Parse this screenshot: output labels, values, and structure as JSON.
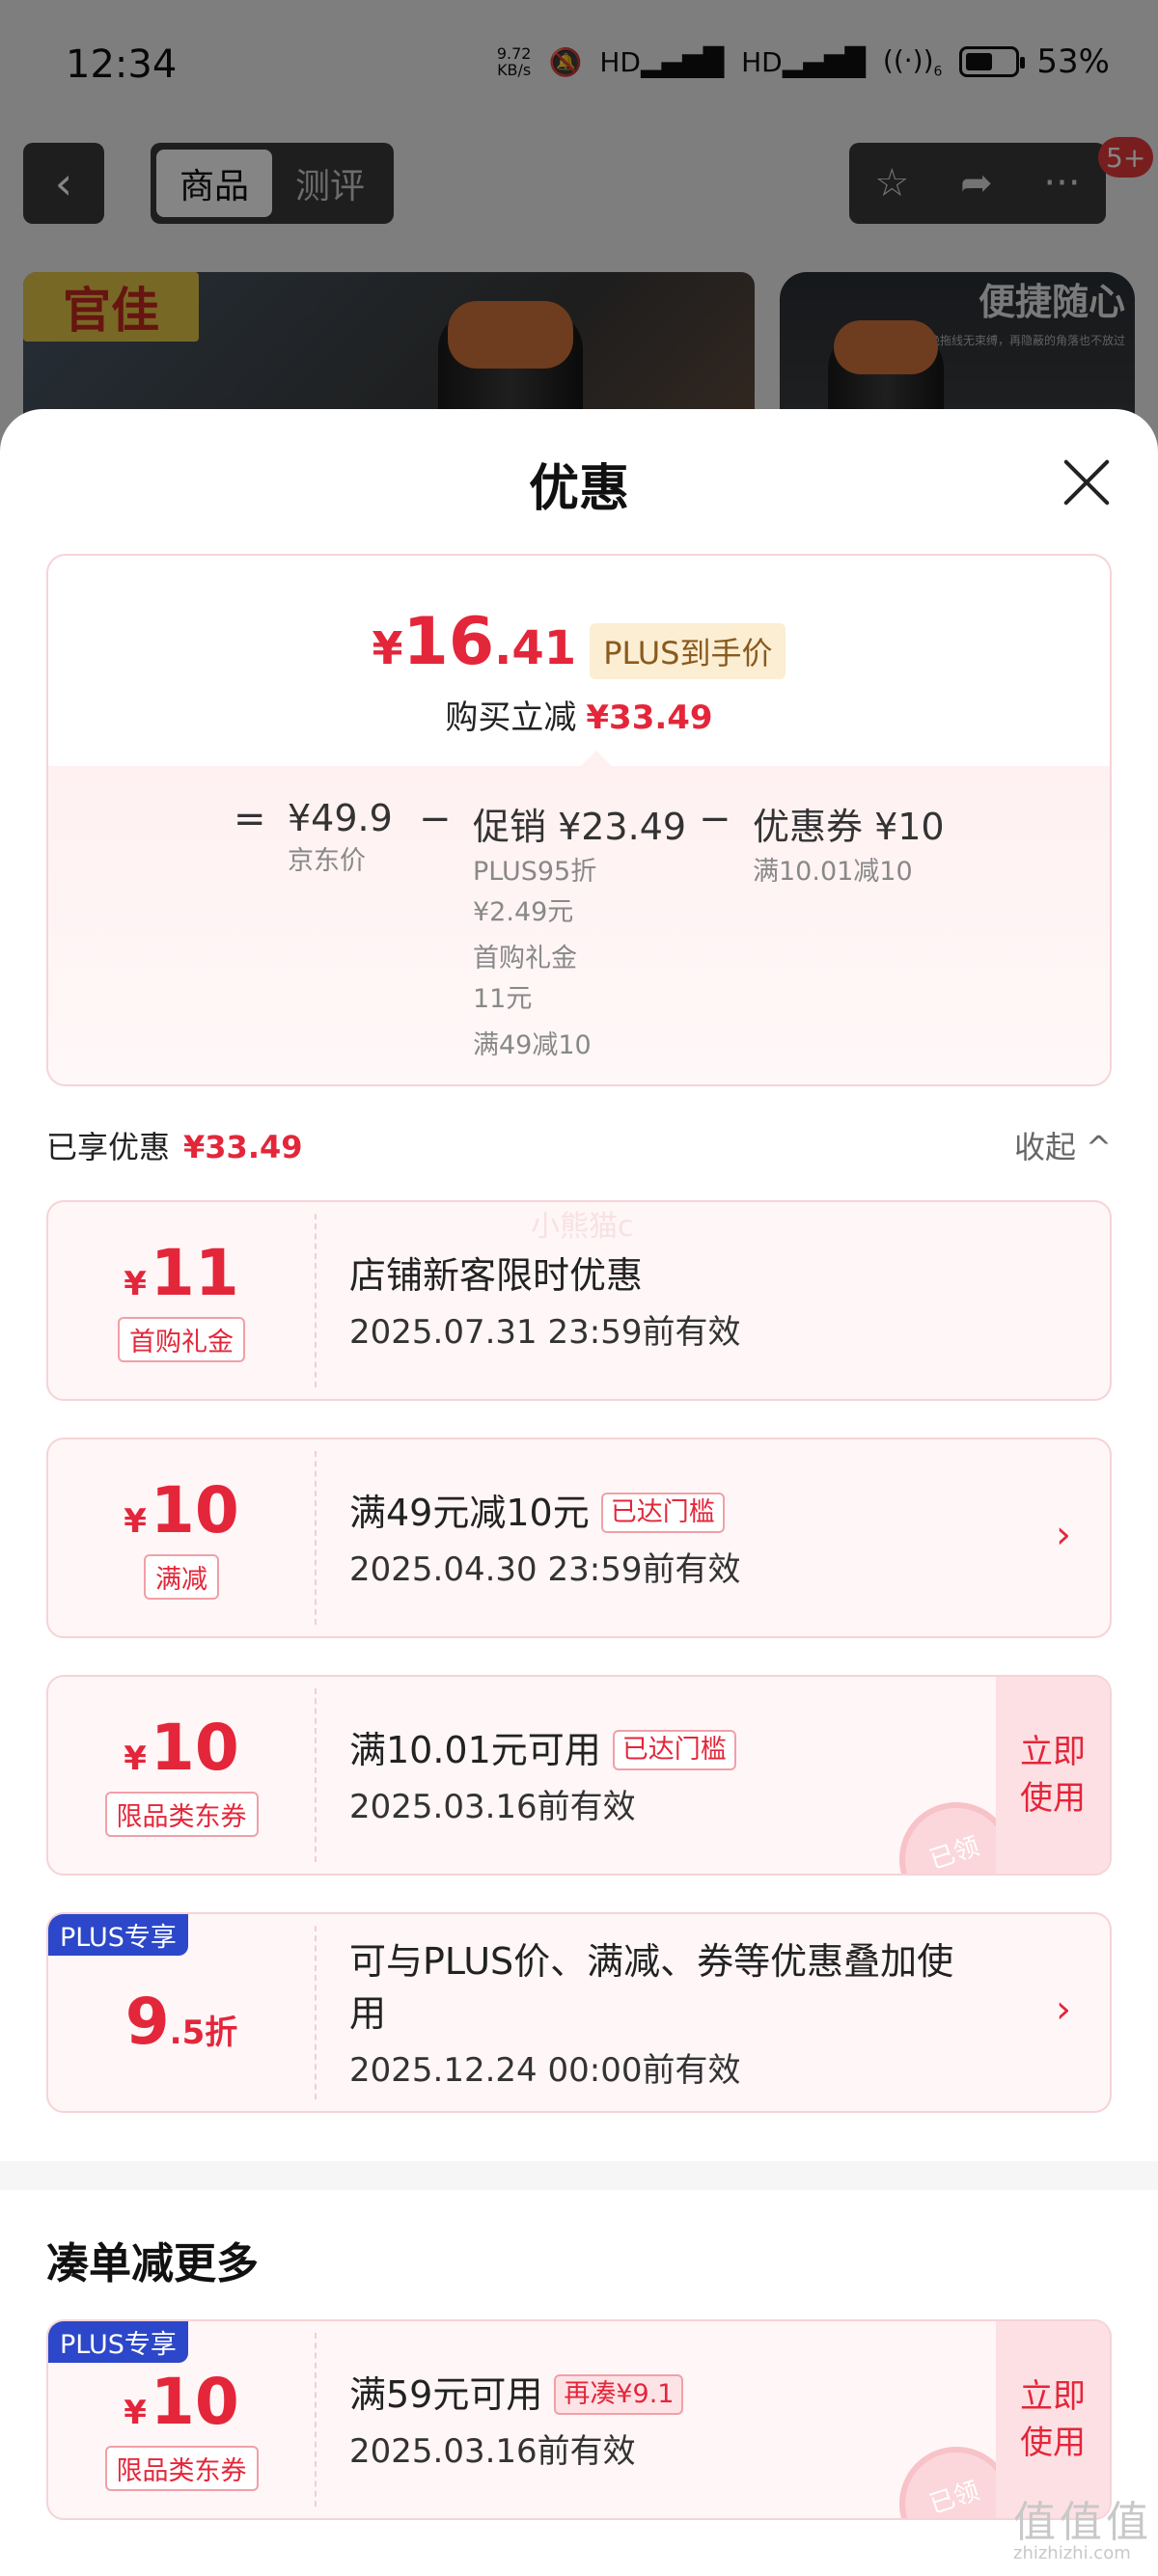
{
  "status_bar": {
    "time": "12:34",
    "net_speed_value": "9.72",
    "net_speed_unit": "KB/s",
    "signal_1": "HD",
    "signal_2": "HD",
    "wifi_level": "6",
    "battery_level": 0.53,
    "battery_text": "53%"
  },
  "top_nav": {
    "tab_product": "商品",
    "tab_review": "测评",
    "notification_count": "5+"
  },
  "banners": {
    "logo_text": "官佳",
    "side_title": "便捷随心",
    "side_sub": "拒绝拖线无束缚，再隐蔽的角落也不放过"
  },
  "sheet": {
    "title": "优惠",
    "final_currency": "¥",
    "final_int": "16",
    "final_dec": ".41",
    "plus_label": "PLUS到手价",
    "reduce_label": "购买立减",
    "reduce_amount": "¥33.49",
    "calc": {
      "eq": "=",
      "jd_price": "¥49.9",
      "jd_label": "京东价",
      "minus1": "−",
      "promo_main": "促销 ¥23.49",
      "promo_line1": "PLUS95折",
      "promo_line2": "¥2.49元",
      "promo_line3": "首购礼金",
      "promo_line4": "11元",
      "promo_line5": "满49减10",
      "minus2": "−",
      "coupon_main": "优惠券 ¥10",
      "coupon_sub": "满10.01减10"
    },
    "enjoyed_label": "已享优惠",
    "enjoyed_amount": "¥33.49",
    "collapse_label": "收起 ^",
    "watermark_mid": "小熊猫c"
  },
  "coupons": [
    {
      "currency": "¥",
      "amount": "11",
      "tag": "首购礼金",
      "title": "店铺新客限时优惠",
      "date": "2025.07.31 23:59前有效"
    },
    {
      "currency": "¥",
      "amount": "10",
      "tag": "满减",
      "title": "满49元减10元",
      "badge": "已达门槛",
      "date": "2025.04.30 23:59前有效",
      "chevron": "›"
    },
    {
      "currency": "¥",
      "amount": "10",
      "tag": "限品类东券",
      "title": "满10.01元可用",
      "badge": "已达门槛",
      "date": "2025.03.16前有效",
      "button_line1": "立即",
      "button_line2": "使用",
      "stamp": "已领"
    },
    {
      "corner": "PLUS专享",
      "amount": "9",
      "amount_small": ".5折",
      "title": "可与PLUS价、满减、券等优惠叠加使用",
      "date": "2025.12.24 00:00前有效",
      "chevron": "›"
    }
  ],
  "more_section": {
    "title": "凑单减更多",
    "coupon": {
      "corner": "PLUS专享",
      "currency": "¥",
      "amount": "10",
      "tag": "限品类东券",
      "title": "满59元可用",
      "badge": "再凑¥9.1",
      "date": "2025.03.16前有效",
      "button_line1": "立即",
      "button_line2": "使用",
      "stamp": "已领"
    }
  },
  "watermark": {
    "text": "值值值",
    "domain": "zhizhizhi.com"
  },
  "colors": {
    "accent_red": "#e4263a",
    "plus_blue": "#2c47c9",
    "plus_gold_bg": "#fbeed3"
  },
  "icons": [
    "back-arrow-icon",
    "star-icon",
    "share-icon",
    "more-dots-icon",
    "close-icon",
    "chevron-up-icon",
    "chevron-right-icon"
  ]
}
